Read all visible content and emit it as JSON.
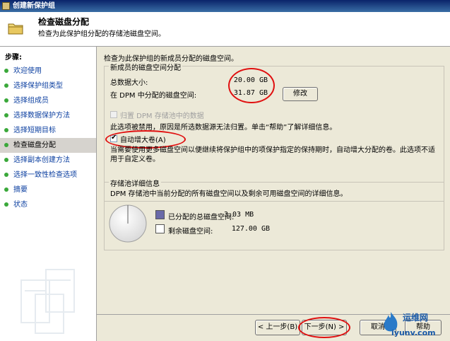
{
  "window": {
    "title": "创建新保护组"
  },
  "header": {
    "title": "检查磁盘分配",
    "subtitle": "检查为此保护组分配的存储池磁盘空间。"
  },
  "sidebar": {
    "steps_label": "步骤:",
    "items": [
      {
        "label": "欢迎使用"
      },
      {
        "label": "选择保护组类型"
      },
      {
        "label": "选择组成员"
      },
      {
        "label": "选择数据保护方法"
      },
      {
        "label": "选择短期目标"
      },
      {
        "label": "检查磁盘分配"
      },
      {
        "label": "选择副本创建方法"
      },
      {
        "label": "选择一致性检查选项"
      },
      {
        "label": "摘要"
      },
      {
        "label": "状态"
      }
    ]
  },
  "main": {
    "intro": "检查为此保护组的新成员分配的磁盘空间。",
    "allocation_group": {
      "label": "新成员的磁盘空间分配",
      "total_data_label": "总数据大小:",
      "total_data_value": "20.00 GB",
      "dpm_alloc_label": "在 DPM 中分配的磁盘空间:",
      "dpm_alloc_value": "31.87 GB",
      "modify_button": "修改",
      "colocate_label": "归置 DPM 存储池中的数据",
      "colocate_note": "此选项被禁用，原因是所选数据源无法归置。单击“帮助”了解详细信息。",
      "autogrow_label": "自动增大卷(A)",
      "autogrow_desc": "当需要使用更多磁盘空间以便继续将保护组中的项保护指定的保持期时，自动增大分配的卷。此选项不适用于自定义卷。"
    },
    "pool_group": {
      "label": "存储池详细信息",
      "desc": "DPM 存储池中当前分配的所有磁盘空间以及剩余可用磁盘空间的详细信息。",
      "allocated_label": "已分配的总磁盘空间:",
      "allocated_value": "3.03 MB",
      "free_label": "剩余磁盘空间:",
      "free_value": "127.00 GB"
    }
  },
  "footer": {
    "back_button": "< 上一步(B)",
    "next_button": "下一步(N) >",
    "cancel_button": "取消",
    "help_button": "帮助"
  },
  "logo": {
    "line1": "运维网",
    "line2": "iyunv.com"
  },
  "colors": {
    "accent_red": "#e01010",
    "allocated_color": "#6a6aa8",
    "free_color": "#ffffff",
    "step_dot": "#3aa83a"
  }
}
